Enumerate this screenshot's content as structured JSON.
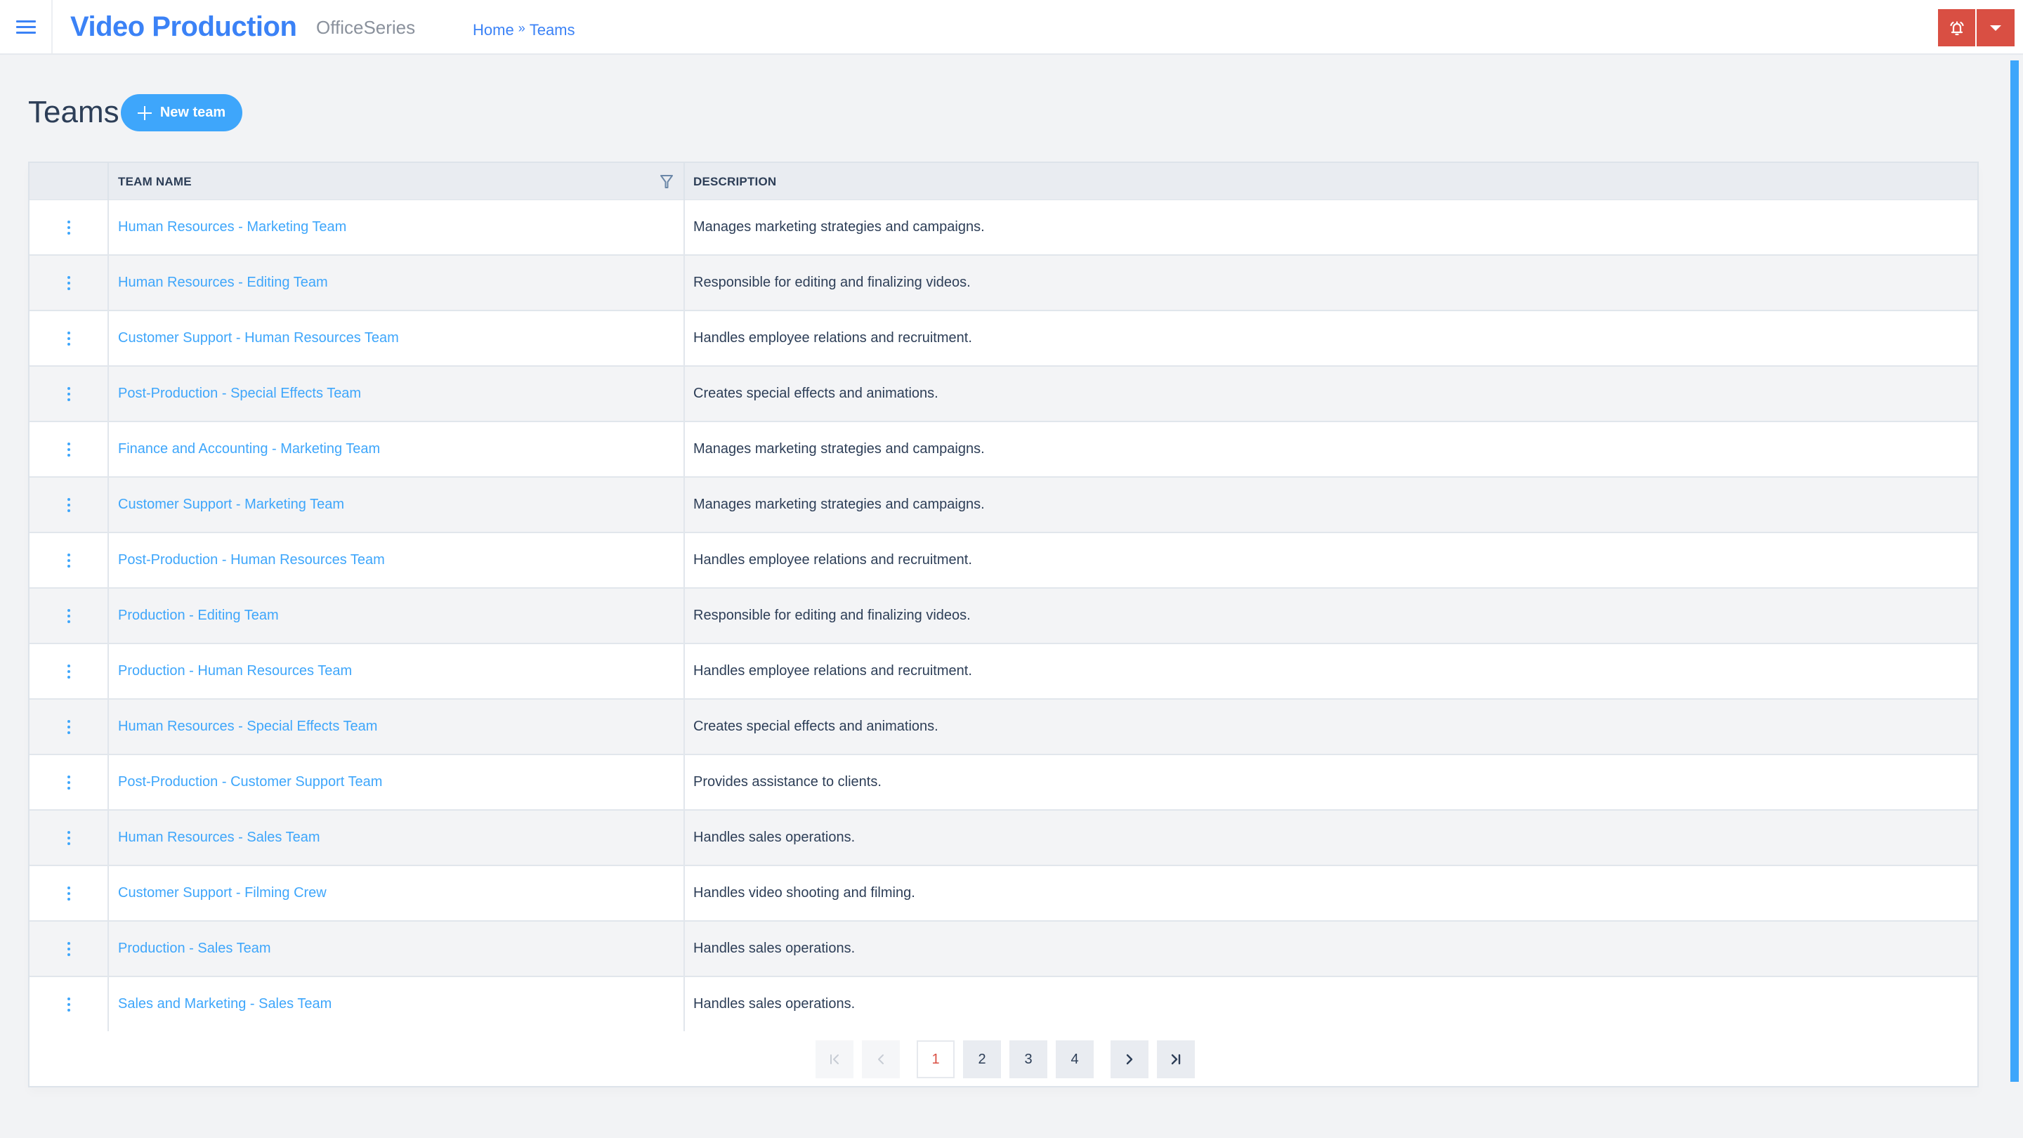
{
  "header": {
    "app_title": "Video Production",
    "app_subtitle": "OfficeSeries",
    "breadcrumb": [
      {
        "label": "Home"
      },
      {
        "label": "Teams"
      }
    ],
    "breadcrumb_separator": "»",
    "menu_icon": "hamburger-menu-icon",
    "notification_icon": "bell-ringing-icon",
    "dropdown_icon": "caret-down-icon",
    "accent_color": "#3b82f6",
    "notification_color": "#d94f43"
  },
  "page": {
    "title": "Teams",
    "new_button_label": "New team",
    "new_button_icon": "plus-icon"
  },
  "table": {
    "columns": [
      {
        "key": "actions",
        "label": ""
      },
      {
        "key": "team_name",
        "label": "TEAM NAME",
        "filterable": true
      },
      {
        "key": "description",
        "label": "DESCRIPTION"
      }
    ],
    "rows": [
      {
        "team_name": "Human Resources - Marketing Team",
        "description": "Manages marketing strategies and campaigns."
      },
      {
        "team_name": "Human Resources - Editing Team",
        "description": "Responsible for editing and finalizing videos."
      },
      {
        "team_name": "Customer Support - Human Resources Team",
        "description": "Handles employee relations and recruitment."
      },
      {
        "team_name": "Post-Production - Special Effects Team",
        "description": "Creates special effects and animations."
      },
      {
        "team_name": "Finance and Accounting - Marketing Team",
        "description": "Manages marketing strategies and campaigns."
      },
      {
        "team_name": "Customer Support - Marketing Team",
        "description": "Manages marketing strategies and campaigns."
      },
      {
        "team_name": "Post-Production - Human Resources Team",
        "description": "Handles employee relations and recruitment."
      },
      {
        "team_name": "Production - Editing Team",
        "description": "Responsible for editing and finalizing videos."
      },
      {
        "team_name": "Production - Human Resources Team",
        "description": "Handles employee relations and recruitment."
      },
      {
        "team_name": "Human Resources - Special Effects Team",
        "description": "Creates special effects and animations."
      },
      {
        "team_name": "Post-Production - Customer Support Team",
        "description": "Provides assistance to clients."
      },
      {
        "team_name": "Human Resources - Sales Team",
        "description": "Handles sales operations."
      },
      {
        "team_name": "Customer Support - Filming Crew",
        "description": "Handles video shooting and filming."
      },
      {
        "team_name": "Production - Sales Team",
        "description": "Handles sales operations."
      },
      {
        "team_name": "Sales and Marketing - Sales Team",
        "description": "Handles sales operations."
      }
    ]
  },
  "pagination": {
    "current_page": "1",
    "pages": [
      "1",
      "2",
      "3",
      "4"
    ],
    "first_disabled": true,
    "prev_disabled": true,
    "next_disabled": false,
    "last_disabled": false
  }
}
